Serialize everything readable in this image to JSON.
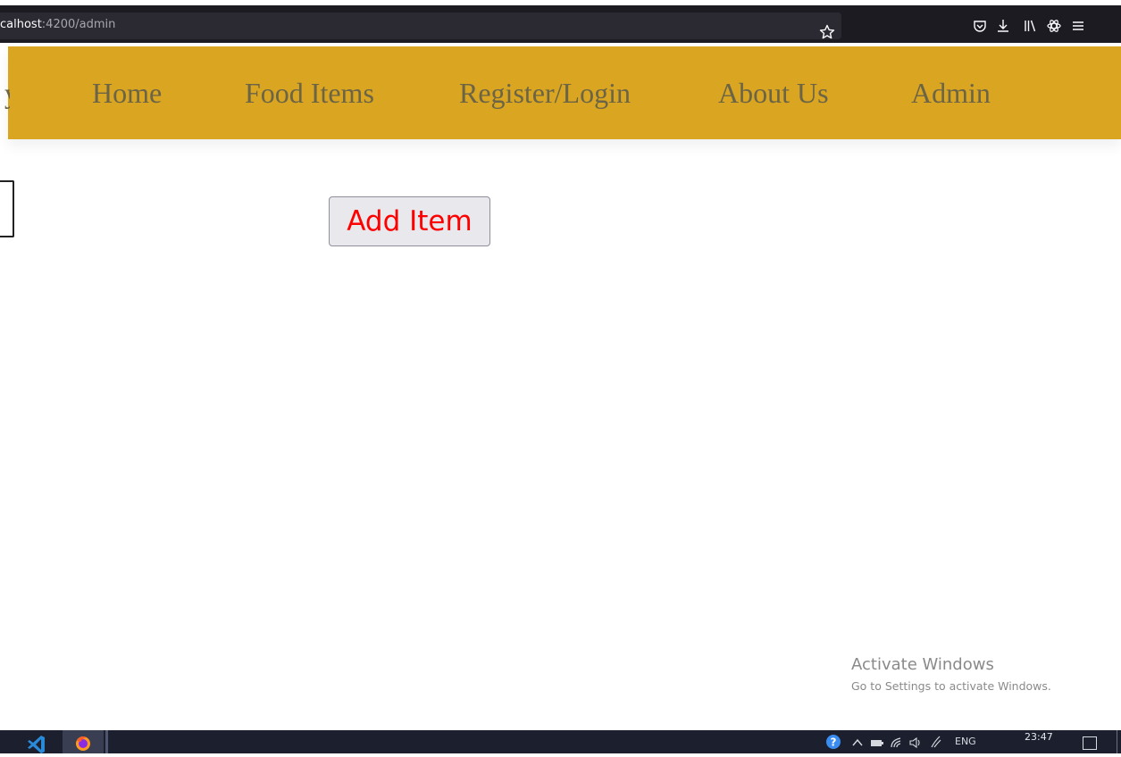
{
  "browser": {
    "url_host": "calhost",
    "url_rest": ":4200/admin",
    "star_icon": "star-icon",
    "toolbar_icons": [
      "pocket-icon",
      "download-icon",
      "library-icon",
      "extension-icon",
      "menu-icon"
    ]
  },
  "nav": {
    "cut_item": "y",
    "items": [
      {
        "label": "Home"
      },
      {
        "label": "Food Items"
      },
      {
        "label": "Register/Login"
      },
      {
        "label": "About Us"
      },
      {
        "label": "Admin"
      }
    ],
    "background_color": "#daa520",
    "text_color": "#6b6446"
  },
  "main": {
    "add_item_label": "Add Item",
    "add_item_color": "#ff0000"
  },
  "watermark": {
    "title": "Activate Windows",
    "subtitle": "Go to Settings to activate Windows."
  },
  "taskbar": {
    "apps": [
      "vscode-icon",
      "firefox-icon"
    ],
    "tray": {
      "language": "ENG",
      "time": "23:47"
    }
  }
}
